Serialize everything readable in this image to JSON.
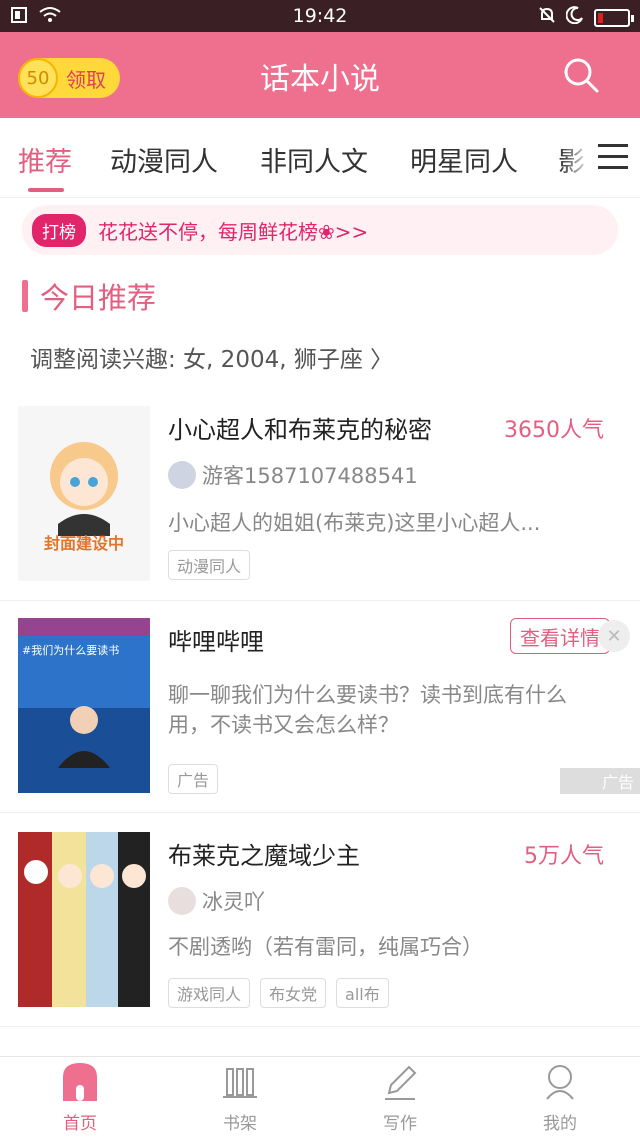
{
  "status_bar": {
    "time": "19:42"
  },
  "header": {
    "coin_value": "50",
    "claim_label": "领取",
    "title": "话本小说"
  },
  "tabs": [
    {
      "label": "推荐"
    },
    {
      "label": "动漫同人"
    },
    {
      "label": "非同人文"
    },
    {
      "label": "明星同人"
    },
    {
      "label": "影"
    }
  ],
  "banner": {
    "badge": "打榜",
    "text": "花花送不停，每周鲜花榜❀>>"
  },
  "section": {
    "title": "今日推荐",
    "interest": "调整阅读兴趣: 女, 2004, 狮子座 〉"
  },
  "cards": [
    {
      "cover_text": "封面建设中",
      "title": "小心超人和布莱克的秘密",
      "popularity": "3650人气",
      "author": "游客1587107488541",
      "desc": "小心超人的姐姐(布莱克)这里小心超人...",
      "tags": [
        "动漫同人"
      ]
    },
    {
      "title": "哔哩哔哩",
      "action": "查看详情",
      "desc": "聊一聊我们为什么要读书？读书到底有什么用，不读书又会怎么样？",
      "tags": [
        "广告"
      ],
      "ad_mark": "广告",
      "cover_text": "#我们为什么要读书"
    },
    {
      "title": "布莱克之魔域少主",
      "popularity": "5万人气",
      "author": "冰灵吖",
      "desc": "不剧透哟（若有雷同，纯属巧合）",
      "tags": [
        "游戏同人",
        "布女党",
        "all布"
      ]
    }
  ],
  "bottom_nav": [
    {
      "label": "首页",
      "icon": "home-icon"
    },
    {
      "label": "书架",
      "icon": "bookshelf-icon"
    },
    {
      "label": "写作",
      "icon": "pen-icon"
    },
    {
      "label": "我的",
      "icon": "profile-icon"
    }
  ],
  "colors": {
    "accent": "#ef6f8f",
    "accent_text": "#e35f81",
    "badge": "#e0256b",
    "coin": "#ffd83a"
  }
}
